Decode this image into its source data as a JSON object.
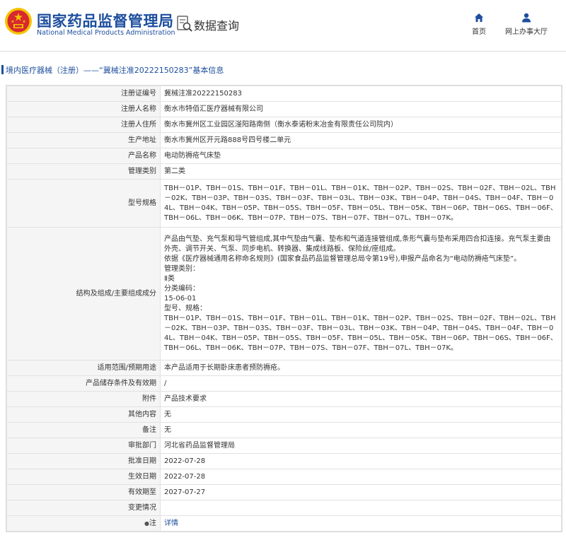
{
  "header": {
    "site_name_cn": "国家药品监督管理局",
    "site_name_en": "National Medical Products Administration",
    "section_title": "数据查询",
    "nav": {
      "home_label": "首页",
      "online_office_label": "网上办事大厅"
    }
  },
  "breadcrumb": {
    "text": "境内医疗器械（注册）——“冀械注准20222150283”基本信息"
  },
  "records": [
    {
      "label": "注册证编号",
      "value": "冀械注准20222150283"
    },
    {
      "label": "注册人名称",
      "value": "衡水市特佰汇医疗器械有限公司"
    },
    {
      "label": "注册人住所",
      "value": "衡水市冀州区工业园区滏阳路南侧（衡水泰诺粉末冶金有限责任公司院内）"
    },
    {
      "label": "生产地址",
      "value": "衡水市冀州区开元路888号四号楼二单元"
    },
    {
      "label": "产品名称",
      "value": "电动防褥疮气床垫"
    },
    {
      "label": "管理类别",
      "value": "第二类"
    },
    {
      "label": "型号规格",
      "value": "TBH－01P、TBH－01S、TBH－01F、TBH－01L、TBH－01K、TBH－02P、TBH－02S、TBH－02F、TBH－02L、TBH－02K、TBH－03P、TBH－03S、TBH－03F、TBH－03L、TBH－03K、TBH－04P、TBH－04S、TBH－04F、TBH－04L、TBH－04K、TBH－05P、TBH－05S、TBH－05F、TBH－05L、TBH－05K、TBH－06P、TBH－06S、TBH－06F、TBH－06L、TBH－06K、TBH－07P、TBH－07S、TBH－07F、TBH－07L、TBH－07K。"
    },
    {
      "label": "结构及组成/主要组成成分",
      "value": "产品由气垫、充气泵和导气管组成,其中气垫由气囊、垫布和气道连接管组成,条形气囊与垫布采用四合扣连接。充气泵主要由外壳、调节开关、气泵、同步电机、转换器、集成线路板、保险丝/座组成。\n依据《医疗器械通用名称命名规则》(国家食品药品监督管理总局令第19号),申报产品命名为“电动防褥疮气床垫”。\n管理类别：\nⅡ类\n分类编码：\n15-06-01\n型号、规格：\nTBH－01P、TBH－01S、TBH－01F、TBH－01L、TBH－01K、TBH－02P、TBH－02S、TBH－02F、TBH－02L、TBH－02K、TBH－03P、TBH－03S、TBH－03F、TBH－03L、TBH－03K、TBH－04P、TBH－04S、TBH－04F、TBH－04L、TBH－04K、TBH－05P、TBH－05S、TBH－05F、TBH－05L、TBH－05K、TBH－06P、TBH－06S、TBH－06F、TBH－06L、TBH－06K、TBH－07P、TBH－07S、TBH－07F、TBH－07L、TBH－07K。"
    },
    {
      "label": "适用范围/预期用途",
      "value": "本产品适用于长期卧床患者预防褥疮。"
    },
    {
      "label": "产品储存条件及有效期",
      "value": "/"
    },
    {
      "label": "附件",
      "value": "产品技术要求"
    },
    {
      "label": "其他内容",
      "value": "无"
    },
    {
      "label": "备注",
      "value": "无"
    },
    {
      "label": "审批部门",
      "value": "河北省药品监督管理局"
    },
    {
      "label": "批准日期",
      "value": "2022-07-28"
    },
    {
      "label": "生效日期",
      "value": "2022-07-28"
    },
    {
      "label": "有效期至",
      "value": "2027-07-27"
    },
    {
      "label": "变更情况",
      "value": ""
    },
    {
      "label": "注",
      "value": "详情"
    }
  ],
  "colors": {
    "brand_blue": "#1d4e9e",
    "emblem_red": "#d7282f",
    "emblem_gold": "#f5c300",
    "label_bg": "#f5f5f5"
  },
  "icons": {
    "emblem": "national-emblem-icon",
    "data_query": "data-query-icon",
    "home": "home-icon",
    "office": "user-icon",
    "note": "note-icon"
  }
}
